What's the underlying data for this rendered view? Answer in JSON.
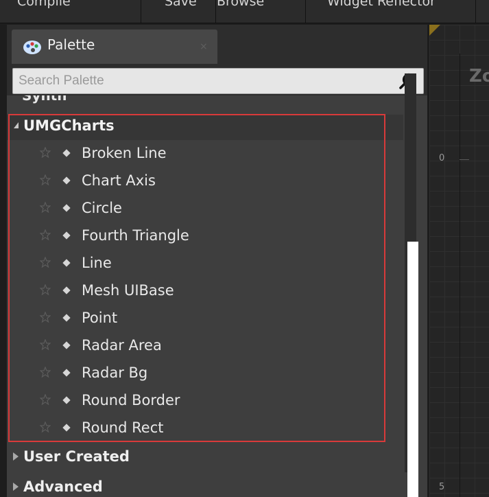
{
  "toolbar": {
    "items": [
      "Compile",
      "Save",
      "Browse",
      "Widget Reflector"
    ]
  },
  "palette": {
    "tab_label": "Palette",
    "tab_close": "×",
    "search_placeholder": "Search Palette",
    "cut_category_label": "Synth",
    "category": {
      "label": "UMGCharts",
      "expanded": true,
      "items": [
        "Broken Line",
        "Chart Axis",
        "Circle",
        "Fourth Triangle",
        "Line",
        "Mesh UIBase",
        "Point",
        "Radar Area",
        "Radar Bg",
        "Round Border",
        "Round Rect"
      ]
    },
    "collapsed_categories": [
      "User Created",
      "Advanced"
    ]
  },
  "canvas": {
    "zoom_text": "Zo",
    "ruler_labels": [
      "0",
      "5"
    ]
  },
  "colors": {
    "highlight": "#d93a3a",
    "panel_bg": "#3e3e3e",
    "search_bg": "#e6e6e6"
  },
  "icons": {
    "tab": "palette-icon",
    "search": "magnifier-icon",
    "favorite": "star-outline-icon",
    "item": "diamond-bullet-icon"
  }
}
